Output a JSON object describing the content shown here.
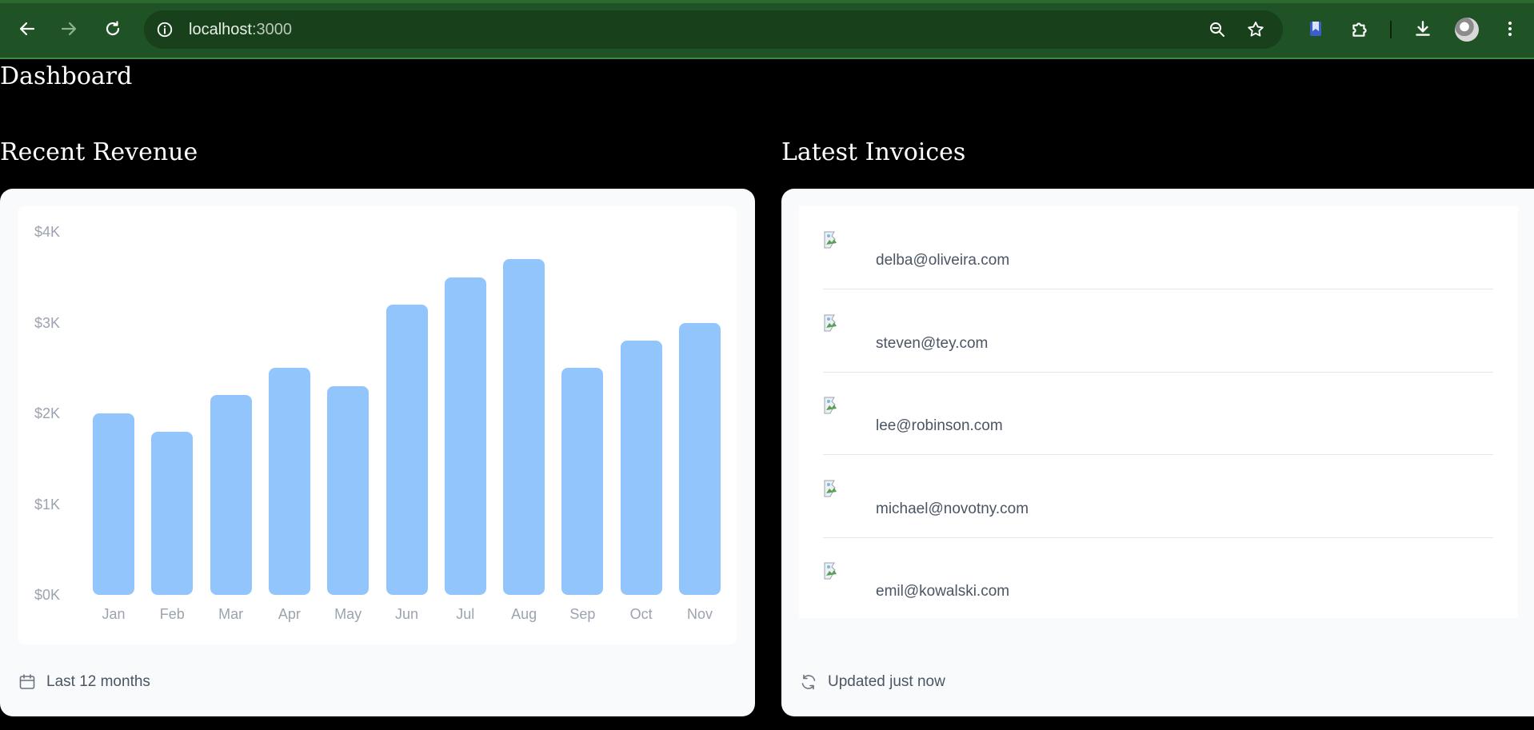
{
  "browser": {
    "url_host": "localhost",
    "url_port": ":3000",
    "icons": [
      "back-arrow-icon",
      "forward-arrow-icon",
      "reload-icon",
      "site-info-icon",
      "zoom-icon",
      "star-icon",
      "bookmark-extension-icon",
      "puzzle-extension-icon",
      "download-icon",
      "profile-avatar",
      "more-menu-icon"
    ]
  },
  "page": {
    "title": "Dashboard"
  },
  "revenue": {
    "title": "Recent Revenue",
    "footer_label": "Last 12 months",
    "footer_icon": "calendar-icon"
  },
  "invoices": {
    "title": "Latest Invoices",
    "footer_label": "Updated just now",
    "footer_icon": "refresh-icon",
    "items": [
      {
        "email": "delba@oliveira.com"
      },
      {
        "email": "steven@tey.com"
      },
      {
        "email": "lee@robinson.com"
      },
      {
        "email": "michael@novotny.com"
      },
      {
        "email": "emil@kowalski.com"
      }
    ]
  },
  "colors": {
    "chrome": "#1f5224",
    "bar": "#93c5fd",
    "card": "#f8fafc"
  },
  "chart_data": {
    "type": "bar",
    "categories": [
      "Jan",
      "Feb",
      "Mar",
      "Apr",
      "May",
      "Jun",
      "Jul",
      "Aug",
      "Sep",
      "Oct",
      "Nov"
    ],
    "values": [
      2000,
      1800,
      2200,
      2500,
      2300,
      3200,
      3500,
      3700,
      2500,
      2800,
      3000
    ],
    "y_ticks": [
      "$4K",
      "$3K",
      "$2K",
      "$1K",
      "$0K"
    ],
    "ylim": [
      0,
      4000
    ],
    "title": "",
    "xlabel": "",
    "ylabel": "",
    "grid": false
  }
}
